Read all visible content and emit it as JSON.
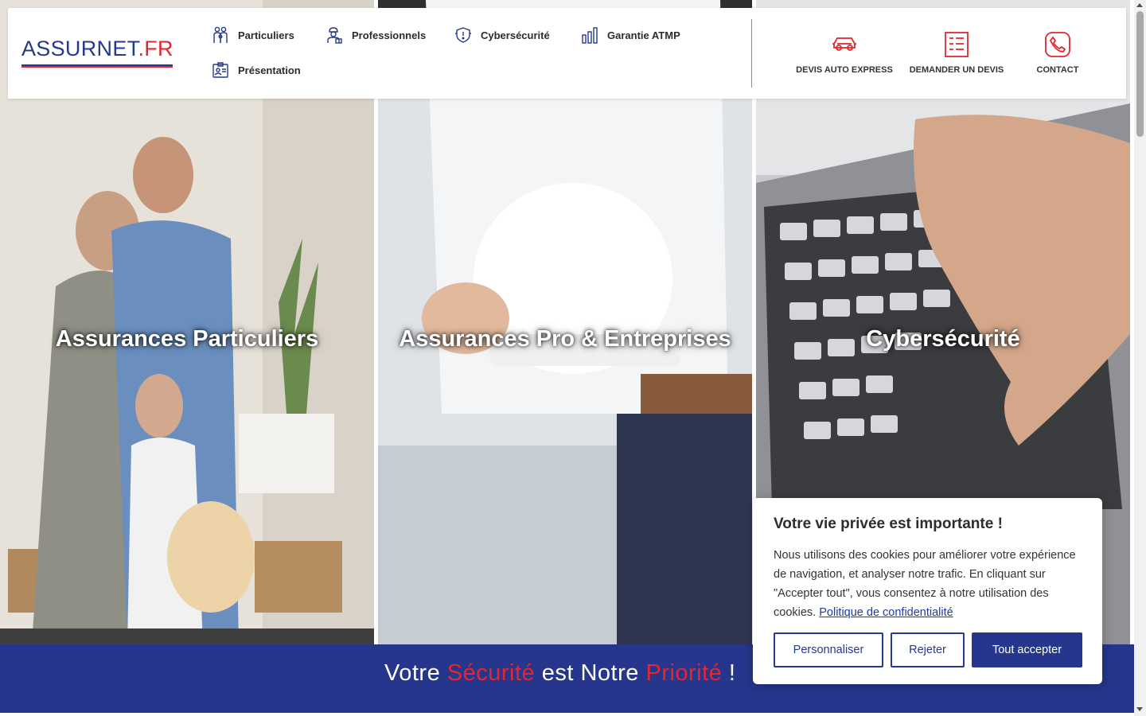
{
  "brand": {
    "logo_main": "ASSURNET",
    "logo_tld": ".FR",
    "blue": "#263a8c",
    "red": "#e3262f"
  },
  "nav": {
    "items": [
      {
        "label": "Particuliers",
        "icon": "family-icon"
      },
      {
        "label": "Professionnels",
        "icon": "worker-icon"
      },
      {
        "label": "Cybersécurité",
        "icon": "shield-icon"
      },
      {
        "label": "Garantie ATMP",
        "icon": "bar-chart-icon"
      },
      {
        "label": "Présentation",
        "icon": "id-card-icon"
      }
    ]
  },
  "actions": [
    {
      "label": "DEVIS AUTO EXPRESS",
      "icon": "car-icon"
    },
    {
      "label": "DEMANDER UN DEVIS",
      "icon": "form-list-icon"
    },
    {
      "label": "CONTACT",
      "icon": "phone-icon"
    }
  ],
  "panels": [
    {
      "title": "Assurances Particuliers"
    },
    {
      "title": "Assurances Pro & Entreprises"
    },
    {
      "title": "Cybersécurité"
    }
  ],
  "tagline": {
    "part1": "Votre ",
    "highlight1": "Sécurité",
    "part2": " est Notre ",
    "highlight2": "Priorité",
    "part3": " !"
  },
  "cookie": {
    "title": "Votre vie privée est importante !",
    "text": "Nous utilisons des cookies pour améliorer votre expérience de navigation, et analyser notre trafic. En cliquant sur \"Accepter tout\", vous consentez à notre utilisation des cookies.",
    "link": "Politique de confidentialité",
    "btn_customize": "Personnaliser",
    "btn_reject": "Rejeter",
    "btn_accept": "Tout accepter"
  }
}
